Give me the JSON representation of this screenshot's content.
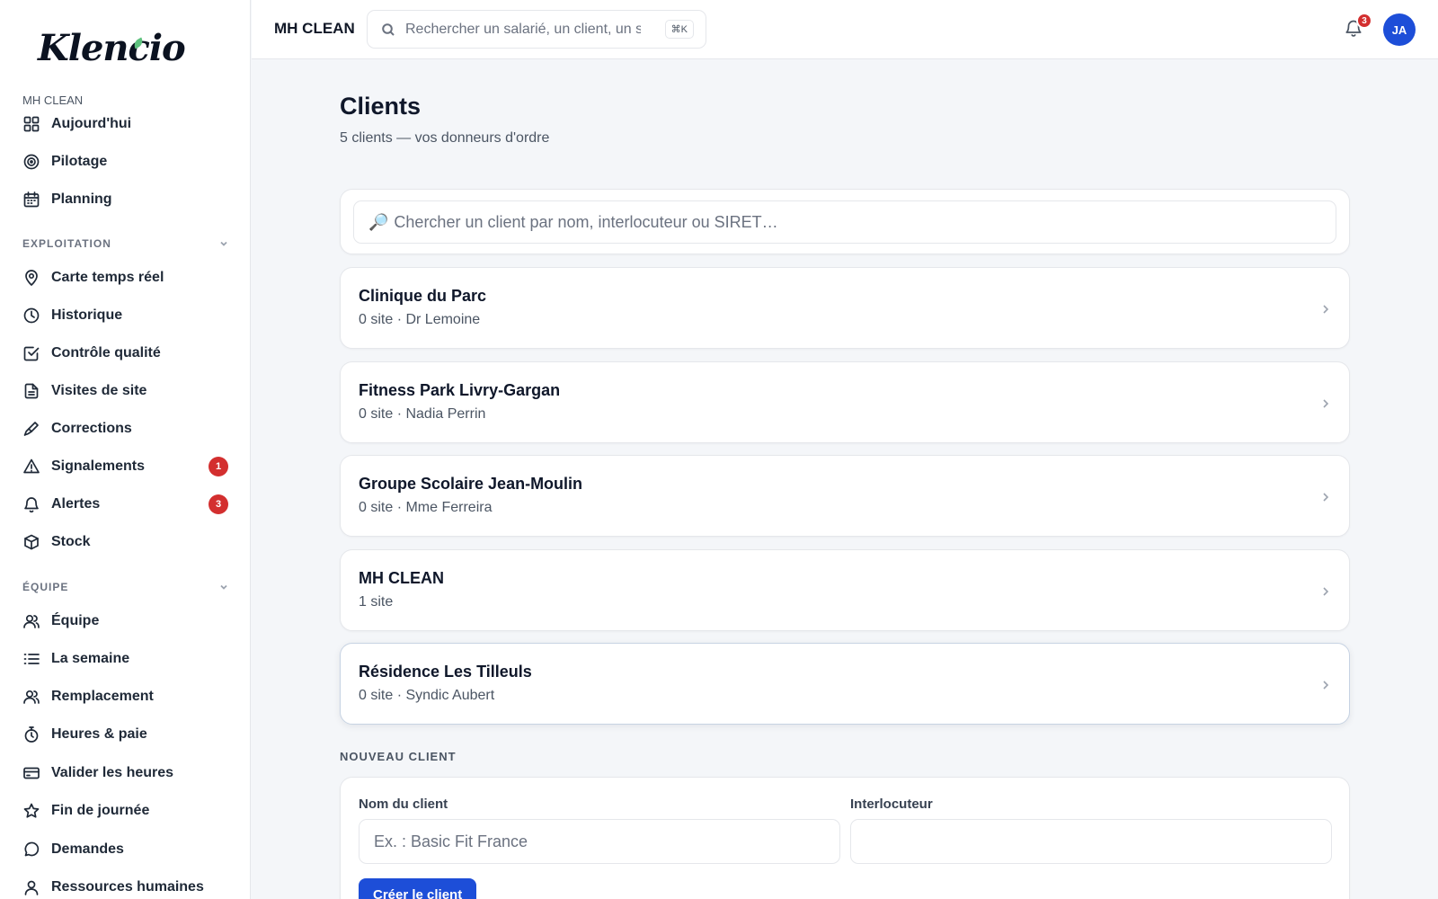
{
  "sidebar": {
    "logo": "Klencio",
    "org": "MH CLEAN",
    "main_items": [
      {
        "label": "Aujourd'hui"
      },
      {
        "label": "Pilotage"
      },
      {
        "label": "Planning"
      }
    ],
    "sections": [
      {
        "title": "EXPLOITATION",
        "items": [
          {
            "label": "Carte temps réel"
          },
          {
            "label": "Historique"
          },
          {
            "label": "Contrôle qualité"
          },
          {
            "label": "Visites de site"
          },
          {
            "label": "Corrections"
          },
          {
            "label": "Signalements",
            "badge": "1"
          },
          {
            "label": "Alertes",
            "badge": "3"
          },
          {
            "label": "Stock"
          }
        ]
      },
      {
        "title": "ÉQUIPE",
        "items": [
          {
            "label": "Équipe"
          },
          {
            "label": "La semaine"
          },
          {
            "label": "Remplacement"
          },
          {
            "label": "Heures & paie"
          },
          {
            "label": "Valider les heures"
          },
          {
            "label": "Fin de journée"
          },
          {
            "label": "Demandes"
          },
          {
            "label": "Ressources humaines"
          }
        ]
      }
    ]
  },
  "topbar": {
    "org": "MH CLEAN",
    "search_placeholder": "Rechercher un salarié, un client, un site…",
    "shortcut": "⌘K",
    "notifications": "3",
    "avatar_initials": "JA"
  },
  "main": {
    "title": "Clients",
    "subtitle": "5 clients — vos donneurs d'ordre",
    "search_placeholder": "Chercher un client par nom, interlocuteur ou SIRET…",
    "clients": [
      {
        "name": "Clinique du Parc",
        "meta": "0 site · Dr Lemoine"
      },
      {
        "name": "Fitness Park Livry-Gargan",
        "meta": "0 site · Nadia Perrin"
      },
      {
        "name": "Groupe Scolaire Jean-Moulin",
        "meta": "0 site · Mme Ferreira"
      },
      {
        "name": "MH CLEAN",
        "meta": "1 site"
      },
      {
        "name": "Résidence Les Tilleuls",
        "meta": "0 site · Syndic Aubert"
      }
    ],
    "new_client": {
      "title": "NOUVEAU CLIENT",
      "name_label": "Nom du client",
      "name_placeholder": "Ex. : Basic Fit France",
      "contact_label": "Interlocuteur",
      "contact_value": "",
      "create_label": "Créer le client"
    }
  },
  "colors": {
    "accent": "#1d4ed8",
    "badge": "#d32f2f",
    "logo_leaf": "#5fc27e"
  }
}
